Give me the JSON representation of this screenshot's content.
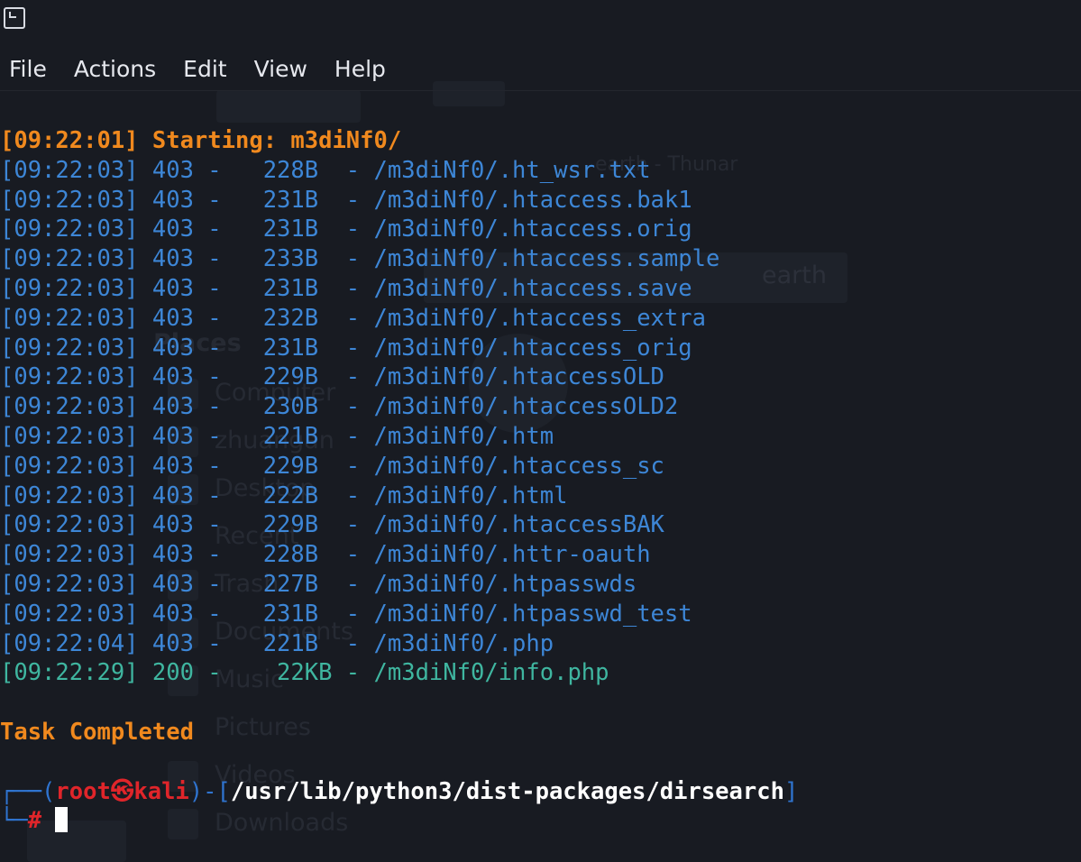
{
  "menu": [
    "File",
    "Actions",
    "Edit",
    "View",
    "Help"
  ],
  "log": {
    "start": "[09:22:01] Starting: m3diNf0/",
    "entries": [
      "[09:22:03] 403 -   228B  - /m3diNf0/.ht_wsr.txt",
      "[09:22:03] 403 -   231B  - /m3diNf0/.htaccess.bak1",
      "[09:22:03] 403 -   231B  - /m3diNf0/.htaccess.orig",
      "[09:22:03] 403 -   233B  - /m3diNf0/.htaccess.sample",
      "[09:22:03] 403 -   231B  - /m3diNf0/.htaccess.save",
      "[09:22:03] 403 -   232B  - /m3diNf0/.htaccess_extra",
      "[09:22:03] 403 -   231B  - /m3diNf0/.htaccess_orig",
      "[09:22:03] 403 -   229B  - /m3diNf0/.htaccessOLD",
      "[09:22:03] 403 -   230B  - /m3diNf0/.htaccessOLD2",
      "[09:22:03] 403 -   221B  - /m3diNf0/.htm",
      "[09:22:03] 403 -   229B  - /m3diNf0/.htaccess_sc",
      "[09:22:03] 403 -   222B  - /m3diNf0/.html",
      "[09:22:03] 403 -   229B  - /m3diNf0/.htaccessBAK",
      "[09:22:03] 403 -   228B  - /m3diNf0/.httr-oauth",
      "[09:22:03] 403 -   227B  - /m3diNf0/.htpasswds",
      "[09:22:03] 403 -   231B  - /m3diNf0/.htpasswd_test",
      "[09:22:04] 403 -   221B  - /m3diNf0/.php"
    ],
    "success": "[09:22:29] 200 -    22KB - /m3diNf0/info.php",
    "completed": "Task Completed"
  },
  "prompt": {
    "open": "┌──(",
    "user": "root",
    "at": "㉿",
    "host": "kali",
    "mid": ")-[",
    "path": "/usr/lib/python3/dist-packages/dirsearch",
    "close": "]",
    "lead": "└─",
    "symbol": "#"
  },
  "ghost": {
    "thunar_title": "earth - Thunar",
    "places": "Places",
    "computer": "Computer",
    "user_dir": "zhuangan",
    "desktop": "Desktop",
    "recent": "Recent",
    "trash": "Trash",
    "documents": "Documents",
    "music": "Music",
    "pictures": "Pictures",
    "videos": "Videos",
    "downloads": "Downloads",
    "path_tab": "earth"
  },
  "colors": {
    "orange": "#f0891e",
    "blue": "#3d86d6",
    "teal": "#3fb6a0",
    "red": "#e0252a"
  }
}
